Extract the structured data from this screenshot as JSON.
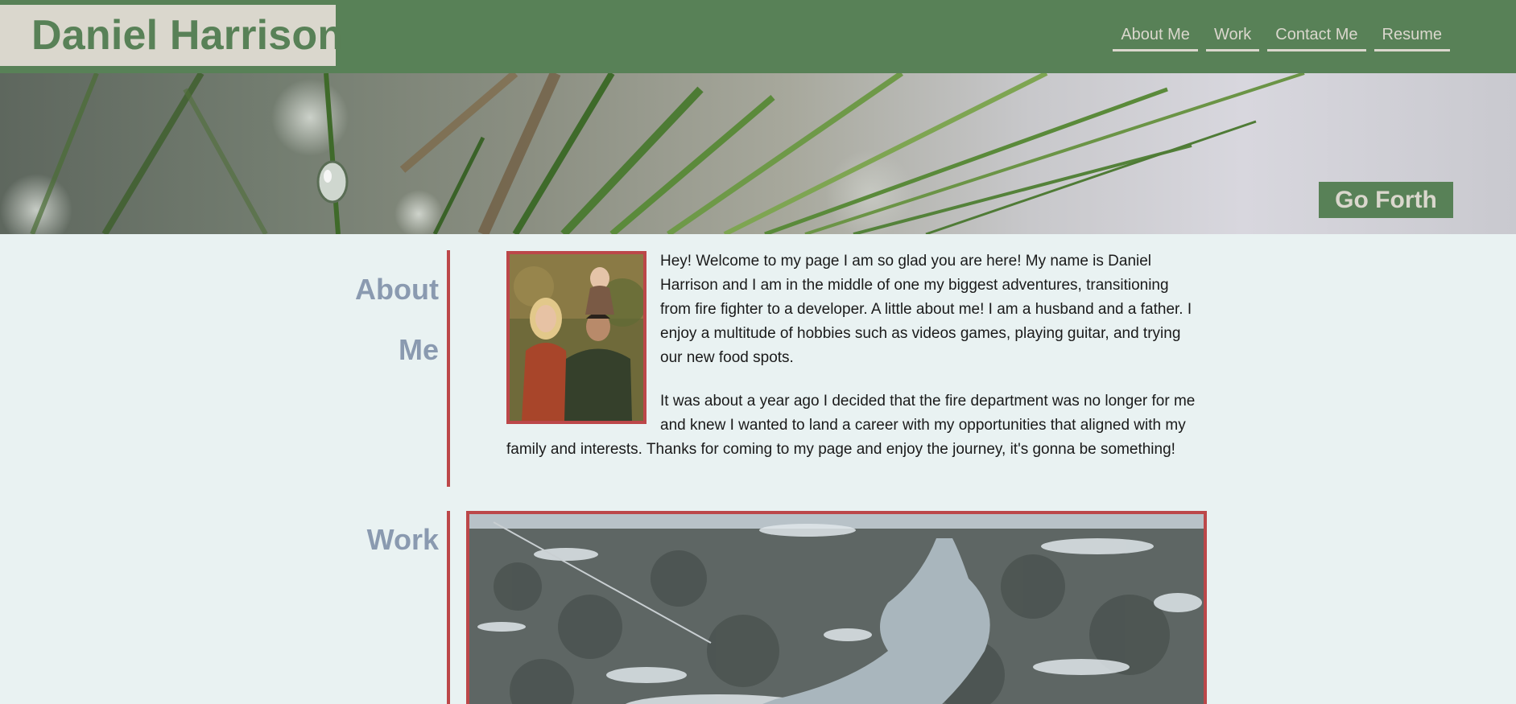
{
  "header": {
    "title": "Daniel Harrison",
    "nav": [
      {
        "label": "About Me"
      },
      {
        "label": "Work"
      },
      {
        "label": "Contact Me"
      },
      {
        "label": "Resume"
      }
    ]
  },
  "hero": {
    "button_label": "Go Forth"
  },
  "about": {
    "title_line1": "About",
    "title_line2": "Me",
    "paragraphs": [
      "Hey! Welcome to my page I am so glad you are here! My name is Daniel Harrison and I am in the middle of one my biggest adventures, transitioning from fire fighter to a developer. A little about me! I am a husband and a father. I enjoy a multitude of hobbies such as videos games, playing guitar, and trying our new food spots.",
      "It was about a year ago I decided that the fire department was no longer for me and knew I wanted to land a career with my opportunities that aligned with my family and interests. Thanks for coming to my page and enjoy the journey, it's gonna be something!"
    ]
  },
  "work": {
    "title": "Work"
  },
  "colors": {
    "header_green": "#588157",
    "cream": "#dad7cd",
    "accent_red": "#bc4749",
    "page_bg": "#e9f2f2",
    "section_title": "#8a9ab0"
  }
}
